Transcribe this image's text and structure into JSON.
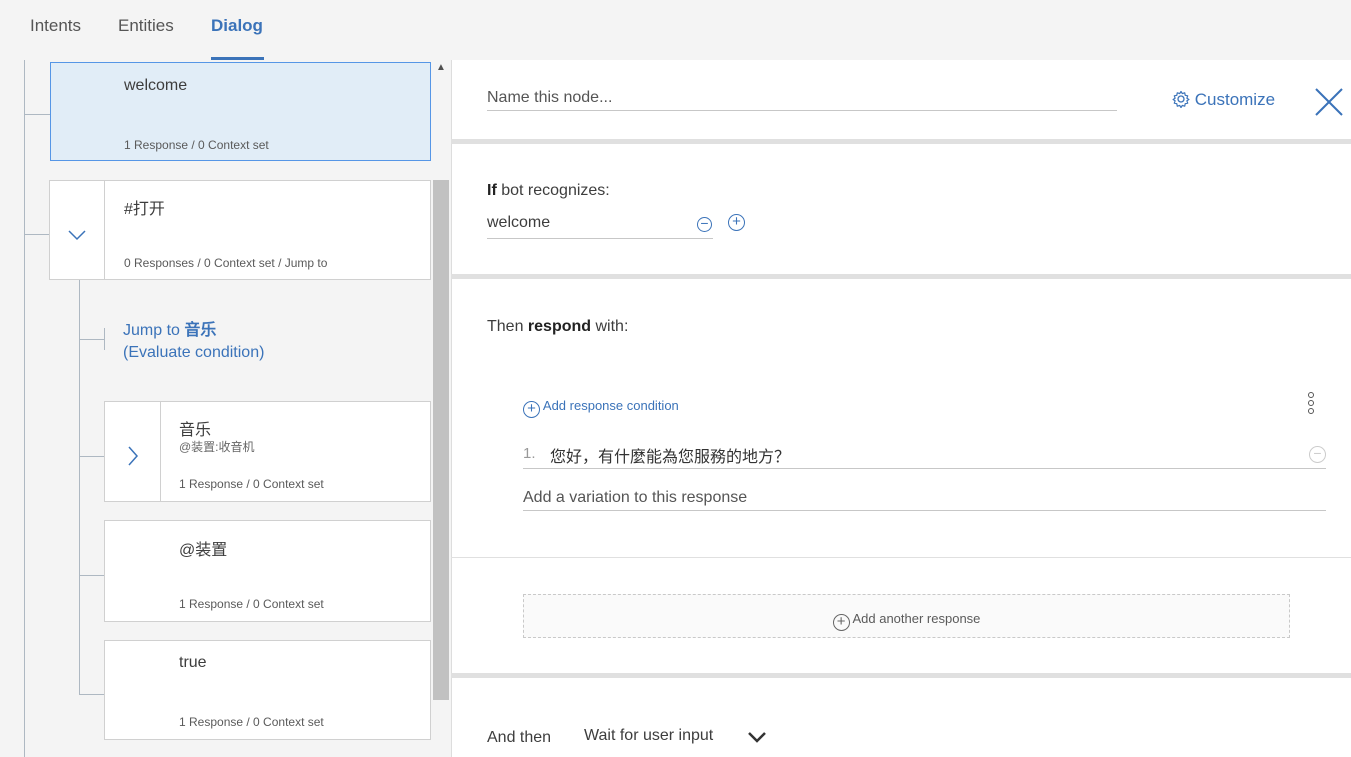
{
  "tabs": [
    {
      "label": "Intents",
      "active": false
    },
    {
      "label": "Entities",
      "active": false
    },
    {
      "label": "Dialog",
      "active": true
    }
  ],
  "tree": {
    "nodes": {
      "welcome": {
        "title": "welcome",
        "meta": "1 Response / 0 Context set"
      },
      "open": {
        "title": "#打开",
        "meta": "0 Responses / 0 Context set / Jump to"
      },
      "jump": {
        "line1_prefix": "Jump to ",
        "line1_target": "音乐",
        "line2": "(Evaluate condition)"
      },
      "music": {
        "title": "音乐",
        "condition": "@装置:收音机",
        "meta": "1 Response / 0 Context set"
      },
      "device": {
        "title": "@装置",
        "meta": "1 Response / 0 Context set"
      },
      "true_node": {
        "title": "true",
        "meta": "1 Response / 0 Context set"
      }
    }
  },
  "editor": {
    "name_placeholder": "Name this node...",
    "customize_label": "Customize",
    "if_bold": "If",
    "if_rest": " bot recognizes:",
    "condition_value": "welcome",
    "then_prefix": "Then ",
    "then_bold": "respond",
    "then_suffix": " with:",
    "add_response_condition": "Add response condition",
    "responses": [
      {
        "num": "1.",
        "text": "您好，有什麼能為您服務的地方？"
      }
    ],
    "variation_placeholder": "Add a variation to this response",
    "add_another_response": "Add another response",
    "and_then_label": "And then",
    "and_then_value": "Wait for user input"
  },
  "colors": {
    "accent": "#3b73b9",
    "selected_bg": "#e1edf7",
    "selected_border": "#5596e6"
  }
}
